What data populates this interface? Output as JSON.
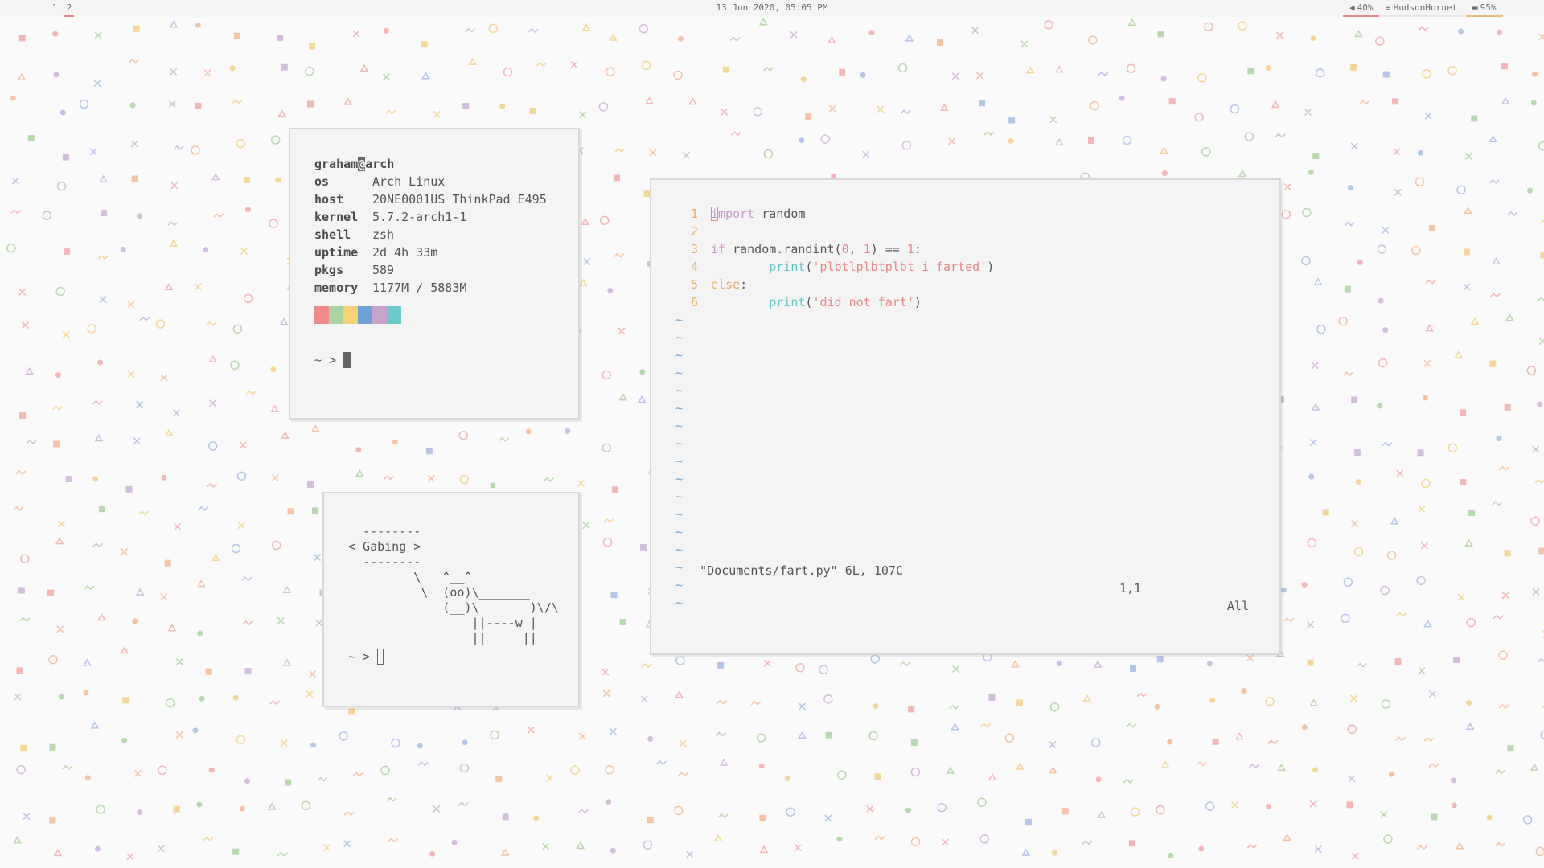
{
  "topbar": {
    "workspaces": [
      "1",
      "2"
    ],
    "active_workspace": "2",
    "clock": "13 Jun 2020, 05:05 PM",
    "volume": "40%",
    "network": "HudsonHornet",
    "battery": "95%",
    "icons": {
      "volume": "speaker-icon",
      "network": "wifi-icon",
      "battery": "battery-icon"
    },
    "colors": {
      "volume": "#e78787",
      "network": "#e0e0e0",
      "battery": "#e6c06e"
    }
  },
  "fetch": {
    "userhost_user": "graham",
    "userhost_at": "@",
    "userhost_host": "arch",
    "rows": [
      {
        "key": "os",
        "value": "Arch Linux"
      },
      {
        "key": "host",
        "value": "20NE0001US ThinkPad E495"
      },
      {
        "key": "kernel",
        "value": "5.7.2-arch1-1"
      },
      {
        "key": "shell",
        "value": "zsh"
      },
      {
        "key": "uptime",
        "value": "2d 4h 33m"
      },
      {
        "key": "pkgs",
        "value": "589"
      },
      {
        "key": "memory",
        "value": "1177M / 5883M"
      }
    ],
    "palette": [
      "#f08a8a",
      "#a9d3a1",
      "#f4d276",
      "#6f9fd4",
      "#c7a4cc",
      "#6ccaca"
    ],
    "prompt": "~ >"
  },
  "cowsay": {
    "art": "  --------\n< Gabing >\n  --------\n         \\   ^__^\n          \\  (oo)\\_______\n             (__)\\       )\\/\\\n                 ||----w |\n                 ||     ||",
    "prompt": "~ >"
  },
  "vim": {
    "lines": [
      {
        "num": "1",
        "tokens": [
          {
            "t": "i",
            "c": "kw-imp cur-i"
          },
          {
            "t": "mport",
            "c": "kw-imp"
          },
          {
            "t": " random",
            "c": ""
          }
        ]
      },
      {
        "num": "2",
        "tokens": []
      },
      {
        "num": "3",
        "tokens": [
          {
            "t": "if",
            "c": "kw-if"
          },
          {
            "t": " random.randint(",
            "c": ""
          },
          {
            "t": "0",
            "c": "num"
          },
          {
            "t": ", ",
            "c": ""
          },
          {
            "t": "1",
            "c": "num"
          },
          {
            "t": ") == ",
            "c": ""
          },
          {
            "t": "1",
            "c": "num"
          },
          {
            "t": ":",
            "c": ""
          }
        ]
      },
      {
        "num": "4",
        "tokens": [
          {
            "t": "        ",
            "c": ""
          },
          {
            "t": "print",
            "c": "fn"
          },
          {
            "t": "(",
            "c": ""
          },
          {
            "t": "'plbtlplbtplbt i farted'",
            "c": "str"
          },
          {
            "t": ")",
            "c": ""
          }
        ]
      },
      {
        "num": "5",
        "tokens": [
          {
            "t": "else",
            "c": "kw-else"
          },
          {
            "t": ":",
            "c": ""
          }
        ]
      },
      {
        "num": "6",
        "tokens": [
          {
            "t": "        ",
            "c": ""
          },
          {
            "t": "print",
            "c": "fn"
          },
          {
            "t": "(",
            "c": ""
          },
          {
            "t": "'did not fart'",
            "c": "str"
          },
          {
            "t": ")",
            "c": ""
          }
        ]
      }
    ],
    "tilde": "~",
    "tilde_count": 17,
    "status_file": "\"Documents/fart.py\" 6L, 107C",
    "status_pos": "1,1",
    "status_scroll": "All"
  }
}
